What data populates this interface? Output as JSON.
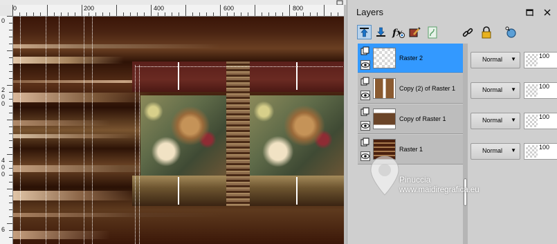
{
  "document": {
    "ruler_top_labels": [
      "0",
      "200",
      "400",
      "600",
      "800"
    ],
    "ruler_left_labels": [
      "0",
      "2",
      "0",
      "0",
      "4",
      "0",
      "0",
      "6"
    ]
  },
  "layers_panel": {
    "title": "Layers",
    "header_icons": [
      "menu-icon",
      "close-icon"
    ],
    "toolbar_icons": [
      "move-layer-up-icon",
      "move-layer-down-icon",
      "layer-styles-icon",
      "edit-selection-icon",
      "mask-icon",
      "link-icon",
      "lock-icon",
      "adjustment-icon"
    ],
    "layers": [
      {
        "name": "Raster 2",
        "blend_mode": "Normal",
        "opacity": "100",
        "selected": true
      },
      {
        "name": "Copy (2) of Raster 1",
        "blend_mode": "Normal",
        "opacity": "100",
        "selected": false
      },
      {
        "name": "Copy of Raster 1",
        "blend_mode": "Normal",
        "opacity": "100",
        "selected": false
      },
      {
        "name": "Raster 1",
        "blend_mode": "Normal",
        "opacity": "100",
        "selected": false
      }
    ]
  },
  "watermark": {
    "name": "Pinuccia",
    "url": "www.maidiregrafica.eu"
  },
  "colors": {
    "selection": "#3399ff",
    "accent_toolbar": "#1a73c8"
  }
}
